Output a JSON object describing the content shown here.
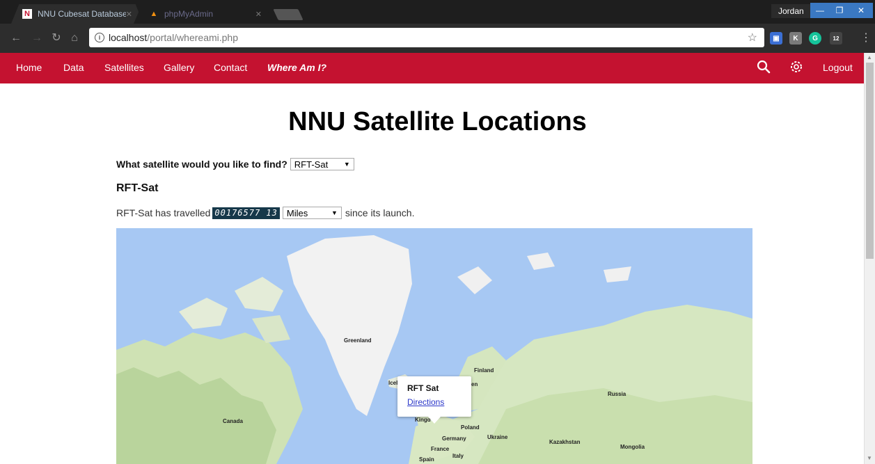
{
  "browser": {
    "tabs": [
      {
        "title": "NNU Cubesat Database",
        "favicon": "N",
        "active": true
      },
      {
        "title": "phpMyAdmin",
        "favicon": "pma",
        "active": false
      }
    ],
    "profile_name": "Jordan",
    "url_host": "localhost",
    "url_path": "/portal/whereami.php",
    "extension_badge": "12"
  },
  "nav": {
    "home": "Home",
    "data": "Data",
    "satellites": "Satellites",
    "gallery": "Gallery",
    "contact": "Contact",
    "where_am_i": "Where Am I?",
    "logout": "Logout"
  },
  "page": {
    "title": "NNU Satellite Locations",
    "question": "What satellite would you like to find?",
    "selected_satellite": "RFT-Sat",
    "satellite_heading": "RFT-Sat",
    "travel_prefix": "RFT-Sat has travelled",
    "odometer": "00176577 13",
    "unit": "Miles",
    "travel_suffix": "since its launch."
  },
  "map": {
    "labels": {
      "greenland": "Greenland",
      "canada": "Canada",
      "iceland": "Icel",
      "finland": "Finland",
      "sweden": "en",
      "russia": "Russia",
      "kingdom": "Kingd",
      "poland": "Poland",
      "germany": "Germany",
      "ukraine": "Ukraine",
      "kazakhstan": "Kazakhstan",
      "mongolia": "Mongolia",
      "france": "France",
      "italy": "Italy",
      "spain": "Spain"
    },
    "popup": {
      "title": "RFT Sat",
      "link": "Directions"
    }
  },
  "colors": {
    "nav_bg": "#c41230",
    "water": "#a7c8f3",
    "land": "#cfe2b4",
    "ice": "#f2f2f2"
  }
}
